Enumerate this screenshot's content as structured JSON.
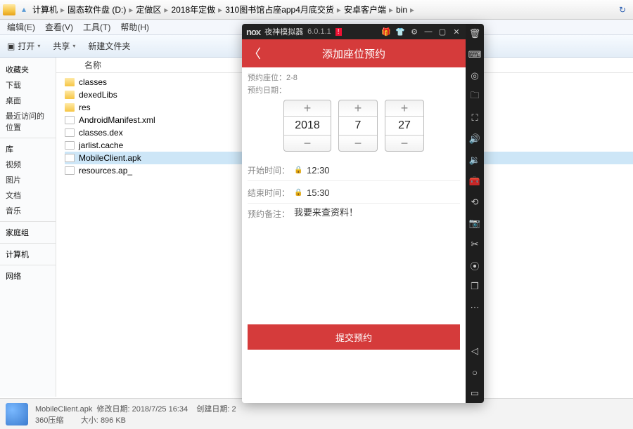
{
  "breadcrumb": [
    "计算机",
    "固态软件盘 (D:)",
    "定做区",
    "2018年定做",
    "310图书馆占座app4月底交货",
    "安卓客户端",
    "bin"
  ],
  "menu": {
    "edit": "编辑(E)",
    "view": "查看(V)",
    "tools": "工具(T)",
    "help": "帮助(H)"
  },
  "toolbar": {
    "open": "打开",
    "share": "共享",
    "newfolder": "新建文件夹"
  },
  "sidebar": {
    "fav": "收藏夹",
    "dl": "下载",
    "desk": "桌面",
    "recent": "最近访问的位置",
    "lib": "库",
    "video": "视频",
    "pic": "图片",
    "doc": "文档",
    "music": "音乐",
    "home": "家庭组",
    "comp": "计算机",
    "net": "网络"
  },
  "listHeader": "名称",
  "files": [
    {
      "name": "classes",
      "type": "dir"
    },
    {
      "name": "dexedLibs",
      "type": "dir"
    },
    {
      "name": "res",
      "type": "dir"
    },
    {
      "name": "AndroidManifest.xml",
      "type": "file"
    },
    {
      "name": "classes.dex",
      "type": "file"
    },
    {
      "name": "jarlist.cache",
      "type": "file"
    },
    {
      "name": "MobileClient.apk",
      "type": "file",
      "sel": true
    },
    {
      "name": "resources.ap_",
      "type": "file"
    }
  ],
  "status": {
    "name": "MobileClient.apk",
    "type": "360压缩",
    "modLabel": "修改日期:",
    "mod": "2018/7/25 16:34",
    "sizeLabel": "大小:",
    "size": "896 KB",
    "createdLabel": "创建日期:",
    "created": "2"
  },
  "emu": {
    "brand": "nox",
    "name": "夜神模拟器",
    "ver": "6.0.1.1",
    "appTitle": "添加座位预约",
    "seatLabel": "预约座位：",
    "seat": "2-8",
    "dateLabel": "预约日期：",
    "date": {
      "y": "2018",
      "m": "7",
      "d": "27"
    },
    "startLabel": "开始时间：",
    "start": "12:30",
    "endLabel": "结束时间：",
    "end": "15:30",
    "noteLabel": "预约备注：",
    "note": "我要来查资料！",
    "submit": "提交预约"
  }
}
